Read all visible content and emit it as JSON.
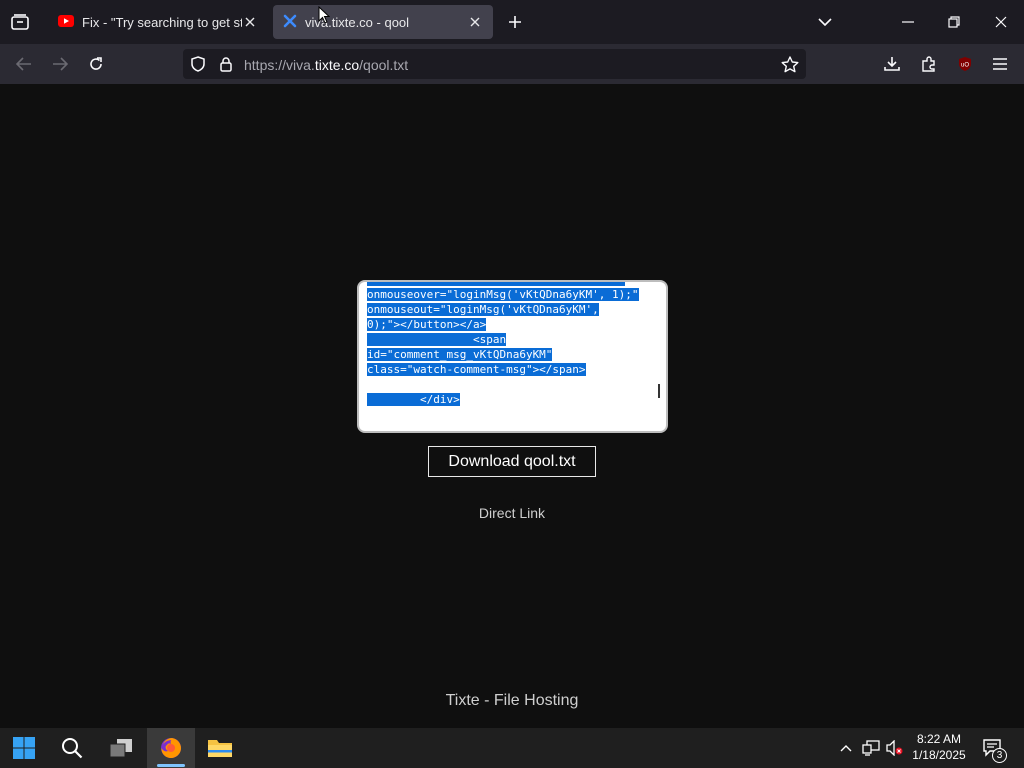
{
  "browser": {
    "tabs": [
      {
        "title": "Fix - \"Try searching to get started\"",
        "icon": "youtube-icon",
        "active": false
      },
      {
        "title": "viva.tixte.co - qool",
        "icon": "tixte-icon",
        "active": true
      }
    ],
    "url_prefix": "https://viva.",
    "url_domain": "tixte.co",
    "url_path": "/qool.txt"
  },
  "page": {
    "code_lines": [
      "onmouseover=\"loginMsg('vKtQDna6yKM', 1);\"",
      "onmouseout=\"loginMsg('vKtQDna6yKM',",
      "0);\"></button></a>",
      "                <span",
      "id=\"comment_msg_vKtQDna6yKM\"",
      "class=\"watch-comment-msg\"></span>",
      "",
      "        </div>"
    ],
    "download_label": "Download qool.txt",
    "direct_link": "Direct Link",
    "footer": "Tixte - File Hosting"
  },
  "taskbar": {
    "time": "8:22 AM",
    "date": "1/18/2025",
    "notification_count": "3"
  },
  "colors": {
    "selection": "#0a6cd6",
    "youtube_red": "#ff0000",
    "tixte_blue": "#3d8bfd"
  }
}
